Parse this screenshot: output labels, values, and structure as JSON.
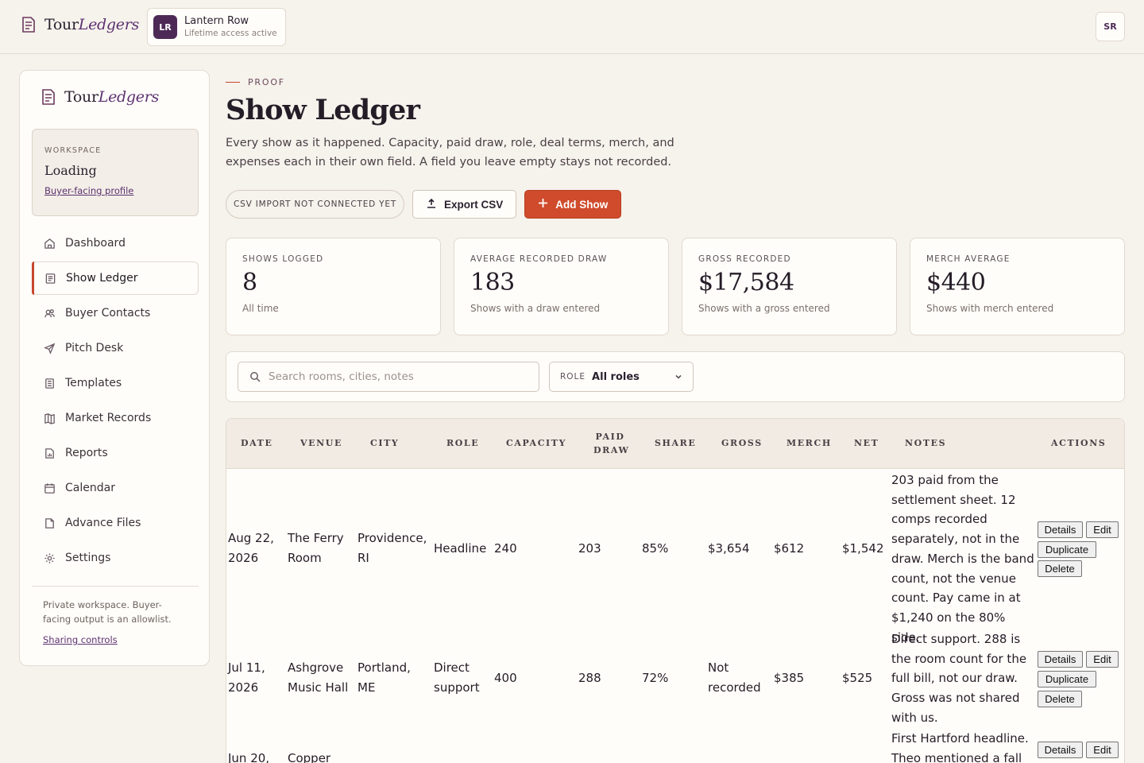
{
  "app": {
    "brand_main": "Tour",
    "brand_accent": "Ledgers"
  },
  "workspace_chip": {
    "initials": "LR",
    "name": "Lantern Row",
    "status": "Lifetime access active"
  },
  "user": {
    "initials": "SR"
  },
  "sidebar": {
    "workspace_label": "WORKSPACE",
    "workspace_value": "Loading",
    "profile_link": "Buyer-facing profile",
    "items": [
      {
        "label": "Dashboard",
        "icon": "home-icon"
      },
      {
        "label": "Show Ledger",
        "icon": "ledger-icon",
        "active": true
      },
      {
        "label": "Buyer Contacts",
        "icon": "contacts-icon"
      },
      {
        "label": "Pitch Desk",
        "icon": "send-icon"
      },
      {
        "label": "Templates",
        "icon": "template-icon"
      },
      {
        "label": "Market Records",
        "icon": "map-icon"
      },
      {
        "label": "Reports",
        "icon": "report-icon"
      },
      {
        "label": "Calendar",
        "icon": "calendar-icon"
      },
      {
        "label": "Advance Files",
        "icon": "file-icon"
      },
      {
        "label": "Settings",
        "icon": "gear-icon"
      }
    ],
    "footer_text": "Private workspace. Buyer-facing output is an allowlist.",
    "footer_link": "Sharing controls"
  },
  "header": {
    "eyebrow": "PROOF",
    "title": "Show Ledger",
    "description": "Every show as it happened. Capacity, paid draw, role, deal terms, merch, and expenses each in their own field. A field you leave empty stays not recorded."
  },
  "actions": {
    "csv_status": "CSV IMPORT NOT CONNECTED YET",
    "export": "Export CSV",
    "add": "Add Show"
  },
  "stats": [
    {
      "label": "SHOWS LOGGED",
      "value": "8",
      "sub": "All time"
    },
    {
      "label": "AVERAGE RECORDED DRAW",
      "value": "183",
      "sub": "Shows with a draw entered"
    },
    {
      "label": "GROSS RECORDED",
      "value": "$17,584",
      "sub": "Shows with a gross entered"
    },
    {
      "label": "MERCH AVERAGE",
      "value": "$440",
      "sub": "Shows with merch entered"
    }
  ],
  "filter": {
    "search_placeholder": "Search rooms, cities, notes",
    "role_label": "ROLE",
    "role_value": "All roles"
  },
  "table": {
    "headers": {
      "date": "DATE",
      "venue": "VENUE",
      "city": "CITY",
      "role": "ROLE",
      "capacity": "CAPACITY",
      "paid_draw_1": "PAID",
      "paid_draw_2": "DRAW",
      "share": "SHARE",
      "gross": "GROSS",
      "merch": "MERCH",
      "net": "NET",
      "notes": "NOTES",
      "actions": "ACTIONS"
    },
    "buttons": {
      "details": "Details",
      "edit": "Edit",
      "duplicate": "Duplicate",
      "delete": "Delete"
    },
    "rows": [
      {
        "date": "Aug 22, 2026",
        "venue": "The Ferry Room",
        "city": "Providence, RI",
        "role": "Headline",
        "capacity": "240",
        "paid_draw": "203",
        "share": "85%",
        "gross": "$3,654",
        "merch": "$612",
        "net": "$1,542",
        "notes": "203 paid from the settlement sheet. 12 comps recorded separately, not in the draw. Merch is the band count, not the venue count. Pay came in at $1,240 on the 80% side."
      },
      {
        "date": "Jul 11, 2026",
        "venue": "Ashgrove Music Hall",
        "city": "Portland, ME",
        "role": "Direct support",
        "capacity": "400",
        "paid_draw": "288",
        "share": "72%",
        "gross": "Not recorded",
        "merch": "$385",
        "net": "$525",
        "notes": "Direct support. 288 is the room count for the full bill, not our draw. Gross was not shared with us."
      },
      {
        "date": "Jun 20,",
        "venue": "Copper",
        "city": "",
        "role": "",
        "capacity": "",
        "paid_draw": "",
        "share": "",
        "gross": "",
        "merch": "",
        "net": "",
        "notes": "First Hartford headline. Theo mentioned a fall"
      }
    ]
  }
}
